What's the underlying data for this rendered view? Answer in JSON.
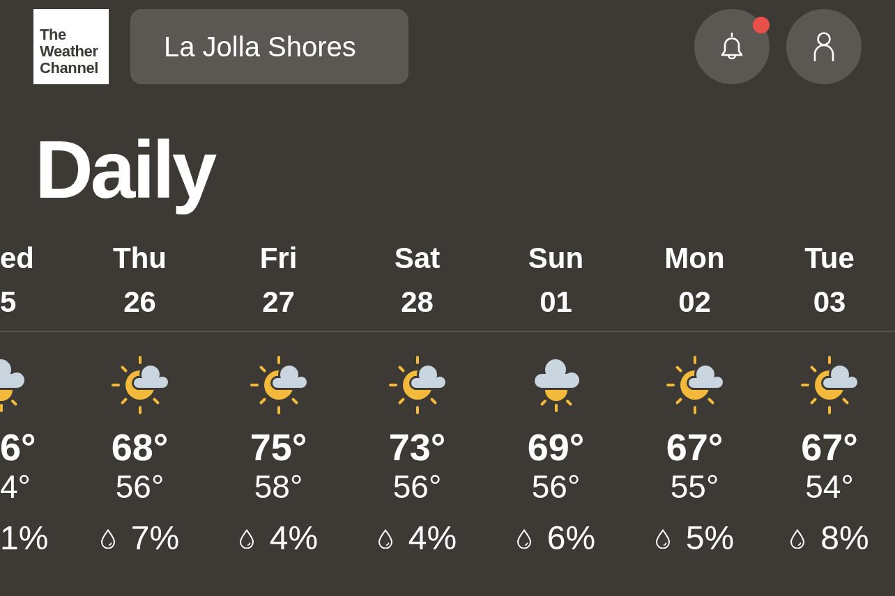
{
  "header": {
    "logo": "The Weather Channel",
    "location": "La Jolla Shores",
    "notifications": {
      "unread": true
    }
  },
  "title": "Daily",
  "days": [
    {
      "clipped": true,
      "day": "ed",
      "date": "5",
      "kind": "mostly_cloudy",
      "high": "6°",
      "low": "4°",
      "precip": "1%"
    },
    {
      "clipped": false,
      "day": "Thu",
      "date": "26",
      "kind": "partly_cloudy",
      "high": "68°",
      "low": "56°",
      "precip": "7%"
    },
    {
      "clipped": false,
      "day": "Fri",
      "date": "27",
      "kind": "partly_cloudy",
      "high": "75°",
      "low": "58°",
      "precip": "4%"
    },
    {
      "clipped": false,
      "day": "Sat",
      "date": "28",
      "kind": "partly_cloudy",
      "high": "73°",
      "low": "56°",
      "precip": "4%"
    },
    {
      "clipped": false,
      "day": "Sun",
      "date": "01",
      "kind": "mostly_cloudy",
      "high": "69°",
      "low": "56°",
      "precip": "6%"
    },
    {
      "clipped": false,
      "day": "Mon",
      "date": "02",
      "kind": "partly_cloudy",
      "high": "67°",
      "low": "55°",
      "precip": "5%"
    },
    {
      "clipped": false,
      "day": "Tue",
      "date": "03",
      "kind": "partly_cloudy",
      "high": "67°",
      "low": "54°",
      "precip": "8%"
    }
  ]
}
